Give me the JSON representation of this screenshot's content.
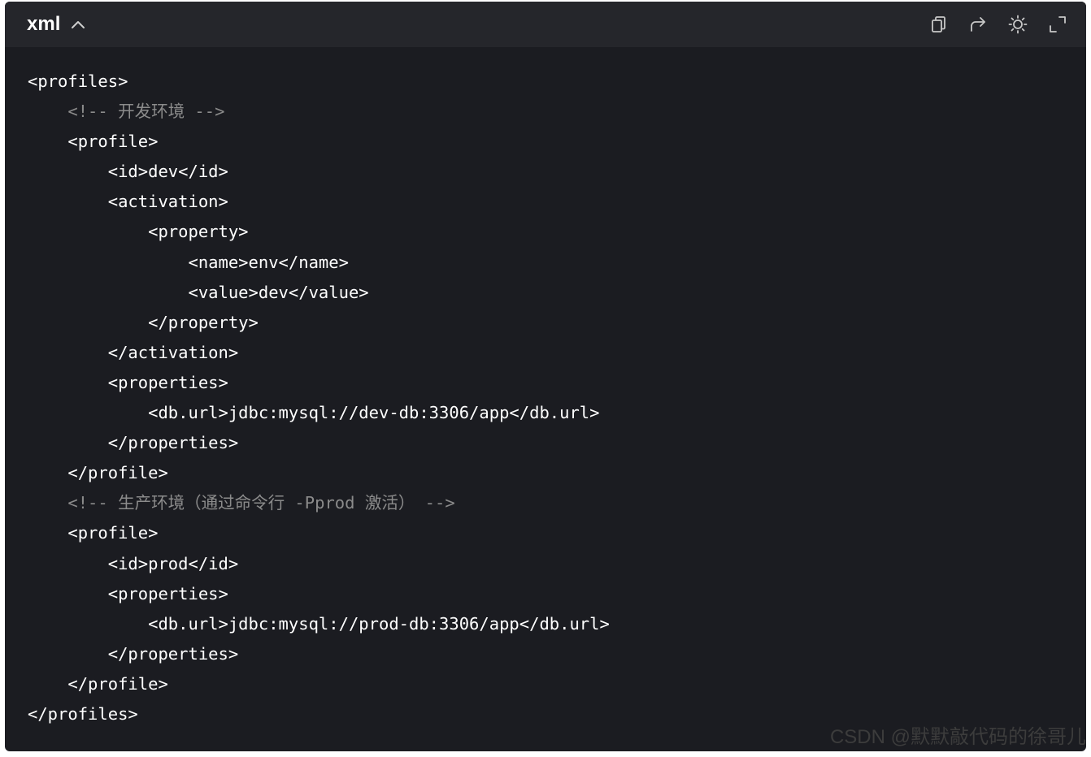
{
  "header": {
    "language": "xml",
    "toolbar": [
      {
        "name": "copy-icon",
        "label": "Copy"
      },
      {
        "name": "share-icon",
        "label": "Share"
      },
      {
        "name": "theme-toggle-icon",
        "label": "Theme"
      },
      {
        "name": "fullscreen-icon",
        "label": "Fullscreen"
      }
    ]
  },
  "code": {
    "lines": [
      {
        "text": "<profiles>",
        "type": "tag"
      },
      {
        "text": "    <!-- 开发环境 -->",
        "type": "comment"
      },
      {
        "text": "    <profile>",
        "type": "tag"
      },
      {
        "text": "        <id>dev</id>",
        "type": "tag"
      },
      {
        "text": "        <activation>",
        "type": "tag"
      },
      {
        "text": "            <property>",
        "type": "tag"
      },
      {
        "text": "                <name>env</name>",
        "type": "tag"
      },
      {
        "text": "                <value>dev</value>",
        "type": "tag"
      },
      {
        "text": "            </property>",
        "type": "tag"
      },
      {
        "text": "        </activation>",
        "type": "tag"
      },
      {
        "text": "        <properties>",
        "type": "tag"
      },
      {
        "text": "            <db.url>jdbc:mysql://dev-db:3306/app</db.url>",
        "type": "tag"
      },
      {
        "text": "        </properties>",
        "type": "tag"
      },
      {
        "text": "    </profile>",
        "type": "tag"
      },
      {
        "text": "    <!-- 生产环境（通过命令行 -Pprod 激活） -->",
        "type": "comment"
      },
      {
        "text": "    <profile>",
        "type": "tag"
      },
      {
        "text": "        <id>prod</id>",
        "type": "tag"
      },
      {
        "text": "        <properties>",
        "type": "tag"
      },
      {
        "text": "            <db.url>jdbc:mysql://prod-db:3306/app</db.url>",
        "type": "tag"
      },
      {
        "text": "        </properties>",
        "type": "tag"
      },
      {
        "text": "    </profile>",
        "type": "tag"
      },
      {
        "text": "</profiles>",
        "type": "tag"
      }
    ]
  },
  "watermark": "CSDN @默默敲代码的徐哥儿",
  "colors": {
    "panel_bg": "#1b1c21",
    "header_bg": "#25262b",
    "code_text": "#ffffff",
    "comment_text": "#8b8b8b"
  }
}
